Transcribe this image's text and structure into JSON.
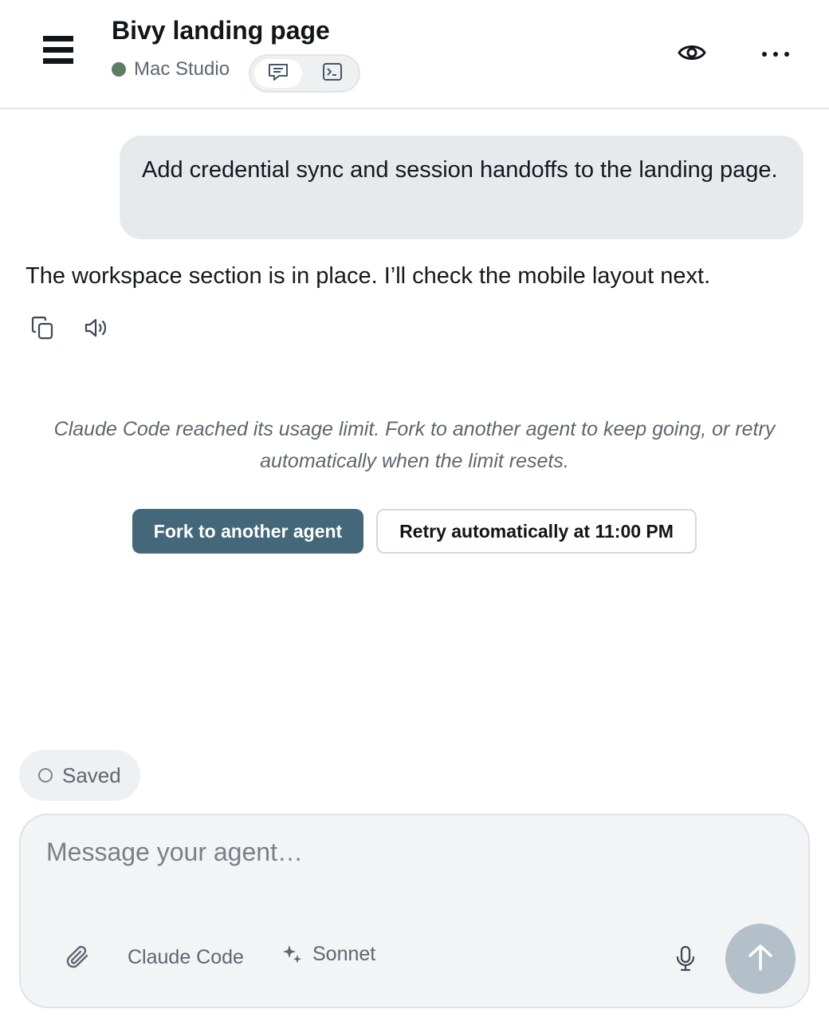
{
  "header": {
    "title": "Bivy landing page",
    "device_name": "Mac Studio",
    "status_color": "#5b7d66",
    "icons": {
      "menu": "hamburger-menu-icon",
      "chat_mode": "chat-bubble-icon",
      "terminal_mode": "terminal-icon",
      "preview": "eye-icon",
      "more": "more-horizontal-icon"
    },
    "active_mode": "chat"
  },
  "conversation": {
    "user_message": "Add credential sync and session handoffs to the landing page.",
    "assistant_message": "The workspace section is in place. I’ll check the mobile layout next.",
    "message_actions": [
      "copy-icon",
      "speaker-icon"
    ]
  },
  "limit_notice": {
    "text": "Claude Code reached its usage limit. Fork to another agent to keep going, or retry automatically when the limit resets.",
    "fork_label": "Fork to another agent",
    "retry_label": "Retry automatically at 11:00 PM",
    "accent_color": "#44687a"
  },
  "status": {
    "saved_label": "Saved"
  },
  "composer": {
    "placeholder": "Message your agent…",
    "value": "",
    "agent_label": "Claude Code",
    "model_label": "Sonnet",
    "icons": {
      "attach": "paperclip-icon",
      "model": "sparkle-icon",
      "mic": "microphone-icon",
      "send": "arrow-up-icon"
    }
  }
}
